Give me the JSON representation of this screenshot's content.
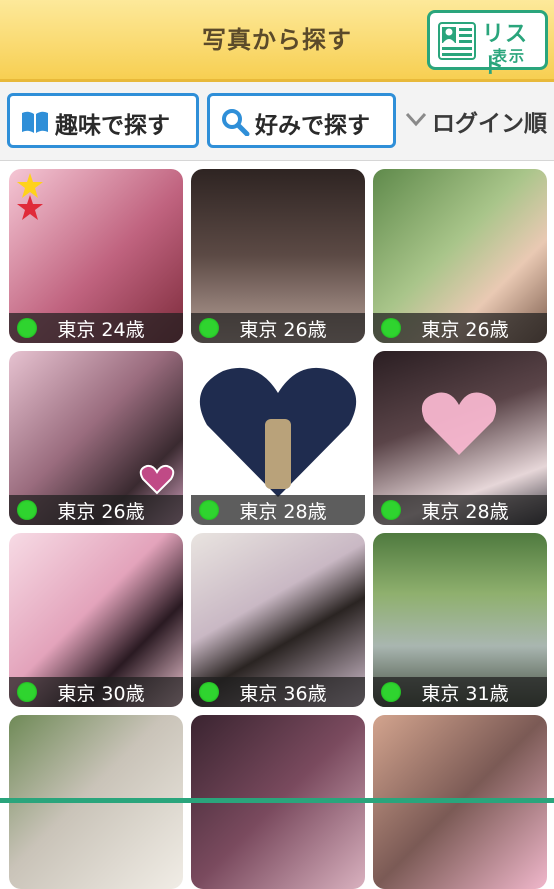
{
  "header": {
    "title": "写真から探す",
    "list_button": {
      "main": "リスト",
      "sub": "表示"
    }
  },
  "search": {
    "hobby_label": "趣味で探す",
    "preference_label": "好みで探す",
    "sort_label": "ログイン順"
  },
  "profiles": [
    {
      "caption": "東京 24歳",
      "online": true,
      "bg": "#d98aa3"
    },
    {
      "caption": "東京 26歳",
      "online": true,
      "bg": "#4b3b38"
    },
    {
      "caption": "東京 26歳",
      "online": true,
      "bg": "#7aa266"
    },
    {
      "caption": "東京 26歳",
      "online": true,
      "bg": "#b58aa0"
    },
    {
      "caption": "東京 28歳",
      "online": true,
      "bg": "#1f2c4f"
    },
    {
      "caption": "東京 28歳",
      "online": true,
      "bg": "#3a2a2e"
    },
    {
      "caption": "東京 30歳",
      "online": true,
      "bg": "#e6b9c9"
    },
    {
      "caption": "東京 36歳",
      "online": true,
      "bg": "#c9b8c4"
    },
    {
      "caption": "東京 31歳",
      "online": true,
      "bg": "#6e8f6a"
    },
    {
      "caption": "",
      "online": false,
      "bg": "#9aa38f"
    },
    {
      "caption": "",
      "online": false,
      "bg": "#5a3a4a"
    },
    {
      "caption": "",
      "online": false,
      "bg": "#7b5a55"
    }
  ]
}
